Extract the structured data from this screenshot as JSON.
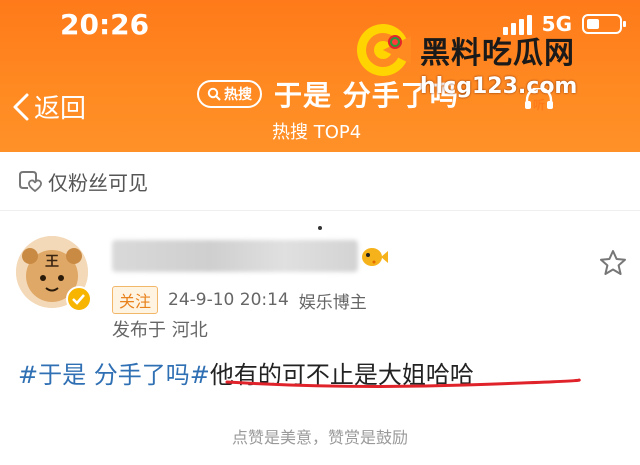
{
  "status": {
    "time": "20:26",
    "network": "5G"
  },
  "nav": {
    "back_label": "返回",
    "hot_tag": "热搜",
    "title": "于是 分手了吗",
    "subtitle": "热搜 TOP4",
    "listen_label": "听"
  },
  "watermark": {
    "title": "黑料吃瓜网",
    "url": "hlcg123.com"
  },
  "visibility": {
    "label": "仅粉丝可见"
  },
  "post": {
    "follow_label": "关注",
    "date": "24-9-10 20:14",
    "user_tag": "娱乐博主",
    "location": "发布于 河北",
    "hashtag": "#于是 分手了吗#",
    "text": "他有的可不止是大姐哈哈"
  },
  "footer": {
    "tip": "点赞是美意，赞赏是鼓励"
  },
  "colors": {
    "header_orange": "#ff8a22",
    "hashtag_blue": "#2f6fb3",
    "underline_red": "#e0222a"
  }
}
